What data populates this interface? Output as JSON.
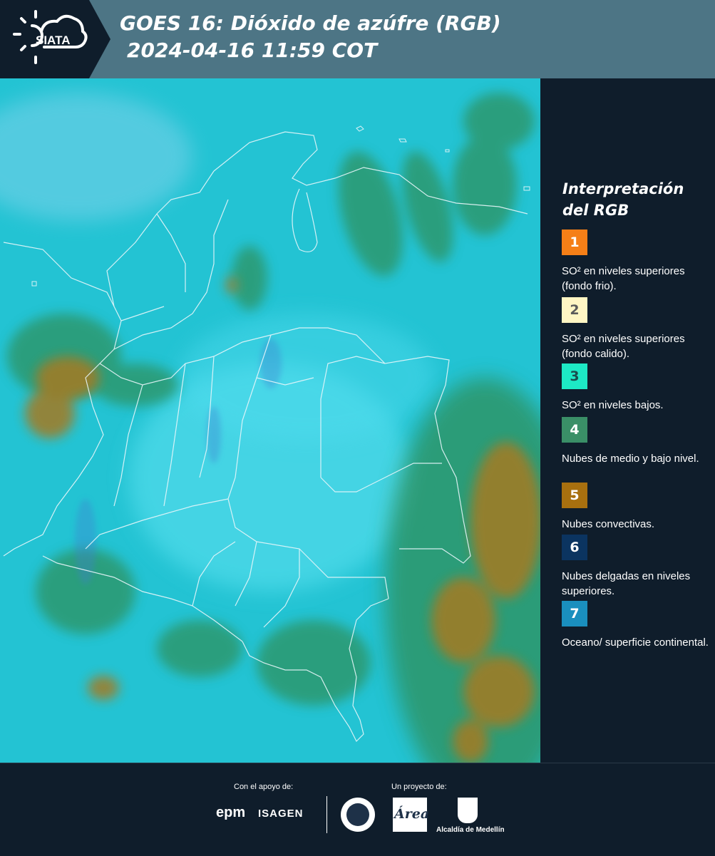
{
  "header": {
    "logo_text": "SIATA",
    "title_line1": "GOES 16: Dióxido de azúfre (RGB)",
    "title_line2": "2024-04-16 11:59 COT"
  },
  "legend": {
    "title_line1": "Interpretación",
    "title_line2": "del RGB",
    "items": [
      {
        "number": "1",
        "label": "SO² en niveles superiores (fondo frio).",
        "color": "#f57f17"
      },
      {
        "number": "2",
        "label": "SO² en niveles superiores (fondo calido).",
        "color": "#fff6c4"
      },
      {
        "number": "3",
        "label": "SO² en niveles bajos.",
        "color": "#1de9c5"
      },
      {
        "number": "4",
        "label": "Nubes de medio y bajo nivel.",
        "color": "#3a8f67"
      },
      {
        "number": "5",
        "label": "Nubes convectivas.",
        "color": "#a8700f"
      },
      {
        "number": "6",
        "label": "Nubes delgadas en niveles superiores.",
        "color": "#0b3460"
      },
      {
        "number": "7",
        "label": "Oceano/ superficie continental.",
        "color": "#1a8fbe"
      }
    ]
  },
  "footer": {
    "support_label": "Con el apoyo de:",
    "project_label": "Un proyecto de:",
    "sponsor_epm": "epm",
    "sponsor_isagen": "ISAGEN",
    "partner_amva": "Área",
    "partner_alcaldia": "Alcaldía de Medellín"
  },
  "colors": {
    "header_bg": "#4d7585",
    "logo_bg": "#0f1d2b",
    "page_bg": "#0f1d2b",
    "map_base": "#23c3d3",
    "map_green": "#2f8f5a",
    "map_brown": "#a57a22"
  }
}
